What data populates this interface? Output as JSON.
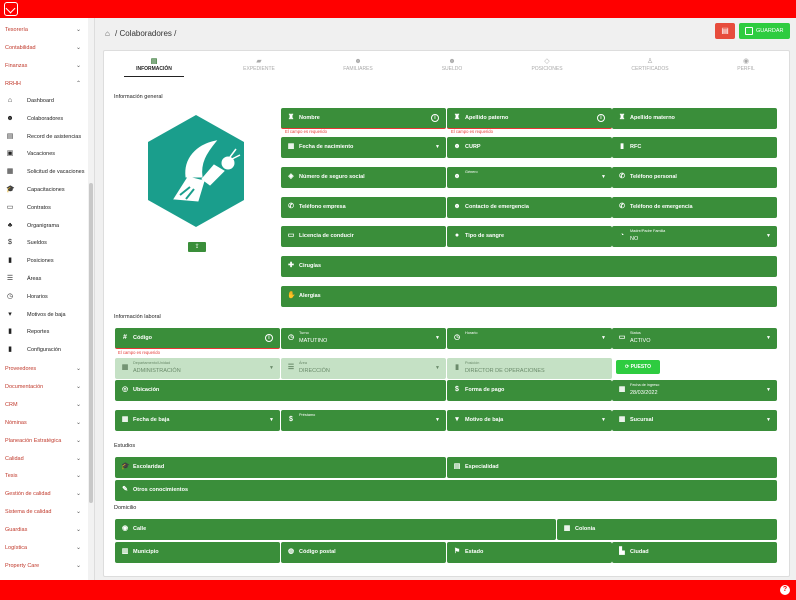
{
  "sidebar": {
    "groups_top": [
      {
        "label": "Tesorería"
      },
      {
        "label": "Contabilidad"
      },
      {
        "label": "Finanzas"
      },
      {
        "label": "RRHH"
      }
    ],
    "rrhh_items": [
      {
        "label": "Dashboard",
        "icon": "⌂"
      },
      {
        "label": "Colaboradores",
        "icon": "☻"
      },
      {
        "label": "Record de asistencias",
        "icon": "▤"
      },
      {
        "label": "Vacaciones",
        "icon": "▣"
      },
      {
        "label": "Solicitud de vacaciones",
        "icon": "▦"
      },
      {
        "label": "Capacitaciones",
        "icon": "🎓"
      },
      {
        "label": "Contratos",
        "icon": "▭"
      },
      {
        "label": "Organigrama",
        "icon": "♣"
      },
      {
        "label": "Sueldos",
        "icon": "$"
      },
      {
        "label": "Posiciones",
        "icon": "▮"
      },
      {
        "label": "Áreas",
        "icon": "☰"
      },
      {
        "label": "Horarios",
        "icon": "◷"
      },
      {
        "label": "Motivos de baja",
        "icon": "▾"
      },
      {
        "label": "Reportes",
        "icon": "▮"
      },
      {
        "label": "Configuración",
        "icon": "▮"
      }
    ],
    "groups_bottom": [
      {
        "label": "Proveedores"
      },
      {
        "label": "Documentación"
      },
      {
        "label": "CRM"
      },
      {
        "label": "Nóminas"
      },
      {
        "label": "Planeación Estratégica"
      },
      {
        "label": "Calidad"
      },
      {
        "label": "Tesis"
      },
      {
        "label": "Gestión de calidad"
      },
      {
        "label": "Sistema de calidad"
      },
      {
        "label": "Guardias"
      },
      {
        "label": "Logística"
      },
      {
        "label": "Property Care"
      }
    ]
  },
  "header": {
    "breadcrumb": "/ Colaboradores /",
    "save_label": "GUARDAR"
  },
  "tabs": [
    {
      "label": "INFORMACIÓN",
      "icon": "▤"
    },
    {
      "label": "EXPEDIENTE",
      "icon": "▰"
    },
    {
      "label": "FAMILIARES",
      "icon": "☻"
    },
    {
      "label": "SUELDO",
      "icon": "☻"
    },
    {
      "label": "POSICIONES",
      "icon": "◇"
    },
    {
      "label": "CERTIFICADOS",
      "icon": "♙"
    },
    {
      "label": "PERFIL",
      "icon": "◉"
    }
  ],
  "sections": {
    "general": "Información general",
    "laboral": "Información laboral",
    "estudios": "Estudios",
    "domicilio": "Domicilio"
  },
  "errors": {
    "required": "El campo es requerido"
  },
  "general_fields": {
    "nombre": "Nombre",
    "apellido_paterno": "Apellido paterno",
    "apellido_materno": "Apellido materno",
    "fecha_nacimiento": "Fecha de nacimiento",
    "curp": "CURP",
    "rfc": "RFC",
    "nss": "Número de seguro social",
    "genero": "Género",
    "tel_personal": "Teléfono personal",
    "tel_empresa": "Teléfono empresa",
    "contacto_emergencia": "Contacto de emergencia",
    "tel_emergencia": "Teléfono de emergencia",
    "licencia": "Licencia de conducir",
    "tipo_sangre": "Tipo de sangre",
    "madre_padre_label": "Madre/Padre Familia",
    "madre_padre_value": "NO",
    "cirugias": "Cirugías",
    "alergias": "Alergias"
  },
  "laboral_fields": {
    "codigo": "Código",
    "turno_label": "Turno",
    "turno_value": "MATUTINO",
    "horario": "Horario",
    "status_label": "Status",
    "status_value": "ACTIVO",
    "depto_label": "Departamento/Unidad",
    "depto_value": "ADMINISTRACIÓN",
    "area_label": "Área",
    "area_value": "DIRECCIÓN",
    "posicion_label": "Posición",
    "posicion_value": "DIRECTOR DE OPERACIONES",
    "puesto_button": "PUESTO",
    "ubicacion": "Ubicación",
    "forma_pago": "Forma de pago",
    "fecha_ingreso_label": "Fecha de ingreso",
    "fecha_ingreso_value": "28/03/2022",
    "fecha_baja": "Fecha de baja",
    "prestamo": "Préstamo",
    "motivo_baja": "Motivo de baja",
    "sucursal": "Sucursal"
  },
  "estudios_fields": {
    "escolaridad": "Escolaridad",
    "especialidad": "Especialidad",
    "otros": "Otros conocimientos"
  },
  "domicilio_fields": {
    "calle": "Calle",
    "colonia": "Colonia",
    "municipio": "Municipio",
    "codigo_postal": "Código postal",
    "estado": "Estado",
    "ciudad": "Ciudad"
  },
  "colors": {
    "topbar": "#ff0000",
    "field": "#3a8e3a",
    "field_light": "#c5e1c5",
    "accent": "#2ecc40",
    "error": "#e53935",
    "logo": "#1a9e8c"
  }
}
